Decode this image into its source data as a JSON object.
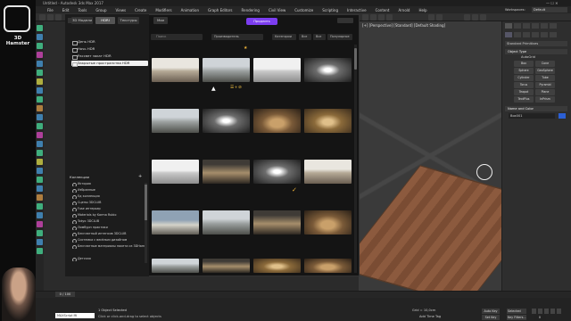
{
  "channel": {
    "name": "3D Hamster"
  },
  "window": {
    "title": "Untitled - Autodesk 3ds Max 2017"
  },
  "menu": [
    "File",
    "Edit",
    "Tools",
    "Group",
    "Views",
    "Create",
    "Modifiers",
    "Animation",
    "Graph Editors",
    "Rendering",
    "Civil View",
    "Customize",
    "Scripting",
    "Interactive",
    "Content",
    "Arnold",
    "Help"
  ],
  "workspace": {
    "label": "Workspaces:",
    "value": "Default"
  },
  "dialog": {
    "tabs": [
      "3D Модели",
      "HDRI",
      "Текстуры",
      "Мои"
    ],
    "buy_label": "Продлить",
    "search_placeholder": "Поиск",
    "filters": [
      "Производитель",
      "Категории",
      "Все",
      "Все",
      "Популярное"
    ],
    "folders": [
      "День HDR",
      "Ночь HDR",
      "Рассвет закат HDR",
      "Закрытые пространства HDR"
    ],
    "selected_folder": "Закрытые пространства HDR",
    "collections_header": "Коллекции",
    "collections": [
      "История",
      "Избранные",
      "Ед коллекция",
      "Сцены 3DCLUB",
      "Fuse интерьер",
      "Materials by Karma Rubio",
      "Tokyo 3DCLUB",
      "Лимбурн практики",
      "Бесплатный интенсив 3DCLUB",
      "Системка с весёлым дизайном",
      "Бесплатные материалы пакета из 3DHamster",
      "Детская"
    ],
    "hover_icons": "☰+⊘"
  },
  "viewport": {
    "label": "[+] [Perspective] [Standard] [Default Shading]"
  },
  "command_panel": {
    "dropdown": "Standard Primitives",
    "object_type": "Object Type",
    "autogrid": "AutoGrid",
    "buttons": [
      "Box",
      "Cone",
      "Sphere",
      "GeoSphere",
      "Cylinder",
      "Tube",
      "Torus",
      "Pyramid",
      "Teapot",
      "Plane",
      "TextPlus",
      "InPrism"
    ],
    "name_color": "Name and Color",
    "object_name": "Box001"
  },
  "timeline": {
    "frame": "0 / 100"
  },
  "status": {
    "selected": "1 Object Selected",
    "hint": "Click or click-and-drag to select objects",
    "script_label": "MAXScript Mi",
    "grid": "Grid = 10,0cm",
    "add_time_tag": "Add Time Tag",
    "auto_key": "Auto Key",
    "set_key": "Set Key",
    "selected_dd": "Selected",
    "key_filters": "Key Filters...",
    "frame_field": "0"
  },
  "colors": {
    "accent": "#7c3df0",
    "star": "#f0b43a"
  }
}
